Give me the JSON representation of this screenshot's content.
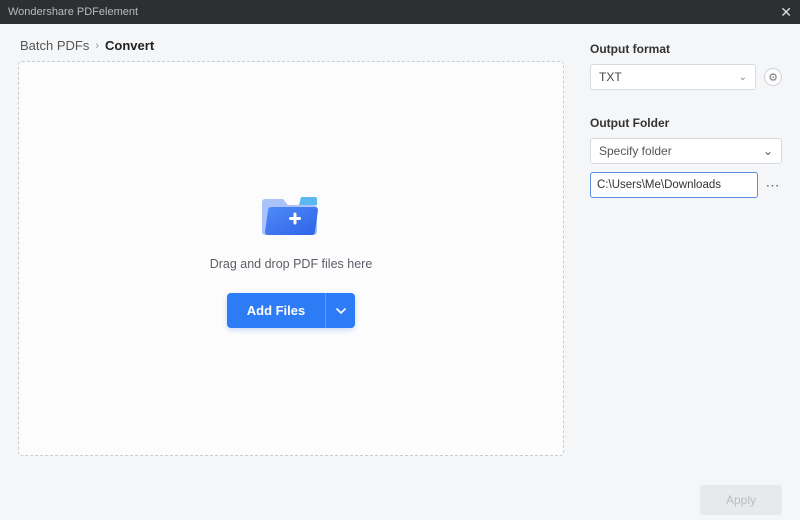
{
  "window": {
    "title": "Wondershare PDFelement"
  },
  "breadcrumb": {
    "parent": "Batch PDFs",
    "current": "Convert"
  },
  "dropzone": {
    "hint": "Drag and drop PDF files here",
    "add_label": "Add Files"
  },
  "panel": {
    "output_format_label": "Output format",
    "output_format_value": "TXT",
    "output_folder_label": "Output Folder",
    "folder_mode": "Specify folder",
    "folder_path": "C:\\Users\\Me\\Downloads"
  },
  "footer": {
    "apply_label": "Apply"
  }
}
